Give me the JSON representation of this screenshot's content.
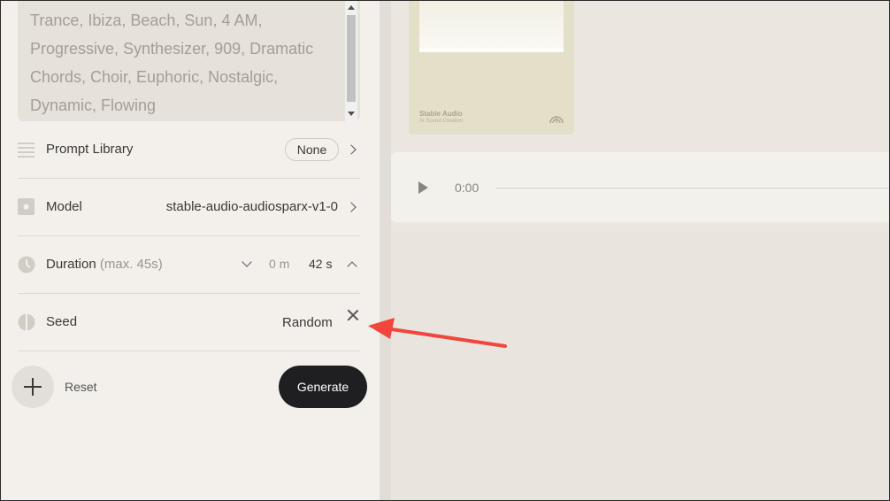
{
  "prompt": {
    "text": "Trance, Ibiza, Beach, Sun, 4 AM,\nProgressive, Synthesizer, 909, Dramatic\nChords, Choir, Euphoric, Nostalgic,\nDynamic, Flowing"
  },
  "settings": {
    "prompt_library": {
      "label": "Prompt Library",
      "value": "None"
    },
    "model": {
      "label": "Model",
      "value": "stable-audio-audiosparx-v1-0"
    },
    "duration": {
      "label": "Duration",
      "hint": "(max. 45s)",
      "minutes": "0 m",
      "seconds": "42 s"
    },
    "seed": {
      "label": "Seed",
      "value": "Random"
    }
  },
  "actions": {
    "reset_label": "Reset",
    "generate_label": "Generate"
  },
  "cover": {
    "title": "Stable Audio",
    "subtitle": "AI Sound Creation"
  },
  "player": {
    "time": "0:00"
  },
  "colors": {
    "annotation_arrow": "#f2453d",
    "generate_bg": "#1f1f22",
    "panel_bg": "#f3f0eb"
  },
  "icons": [
    "menu-lines-icon",
    "model-square-icon",
    "clock-icon",
    "seed-half-circle-icon",
    "chevron-right-icon",
    "chevron-down-icon",
    "chevron-up-icon",
    "close-icon",
    "plus-icon",
    "play-icon"
  ]
}
